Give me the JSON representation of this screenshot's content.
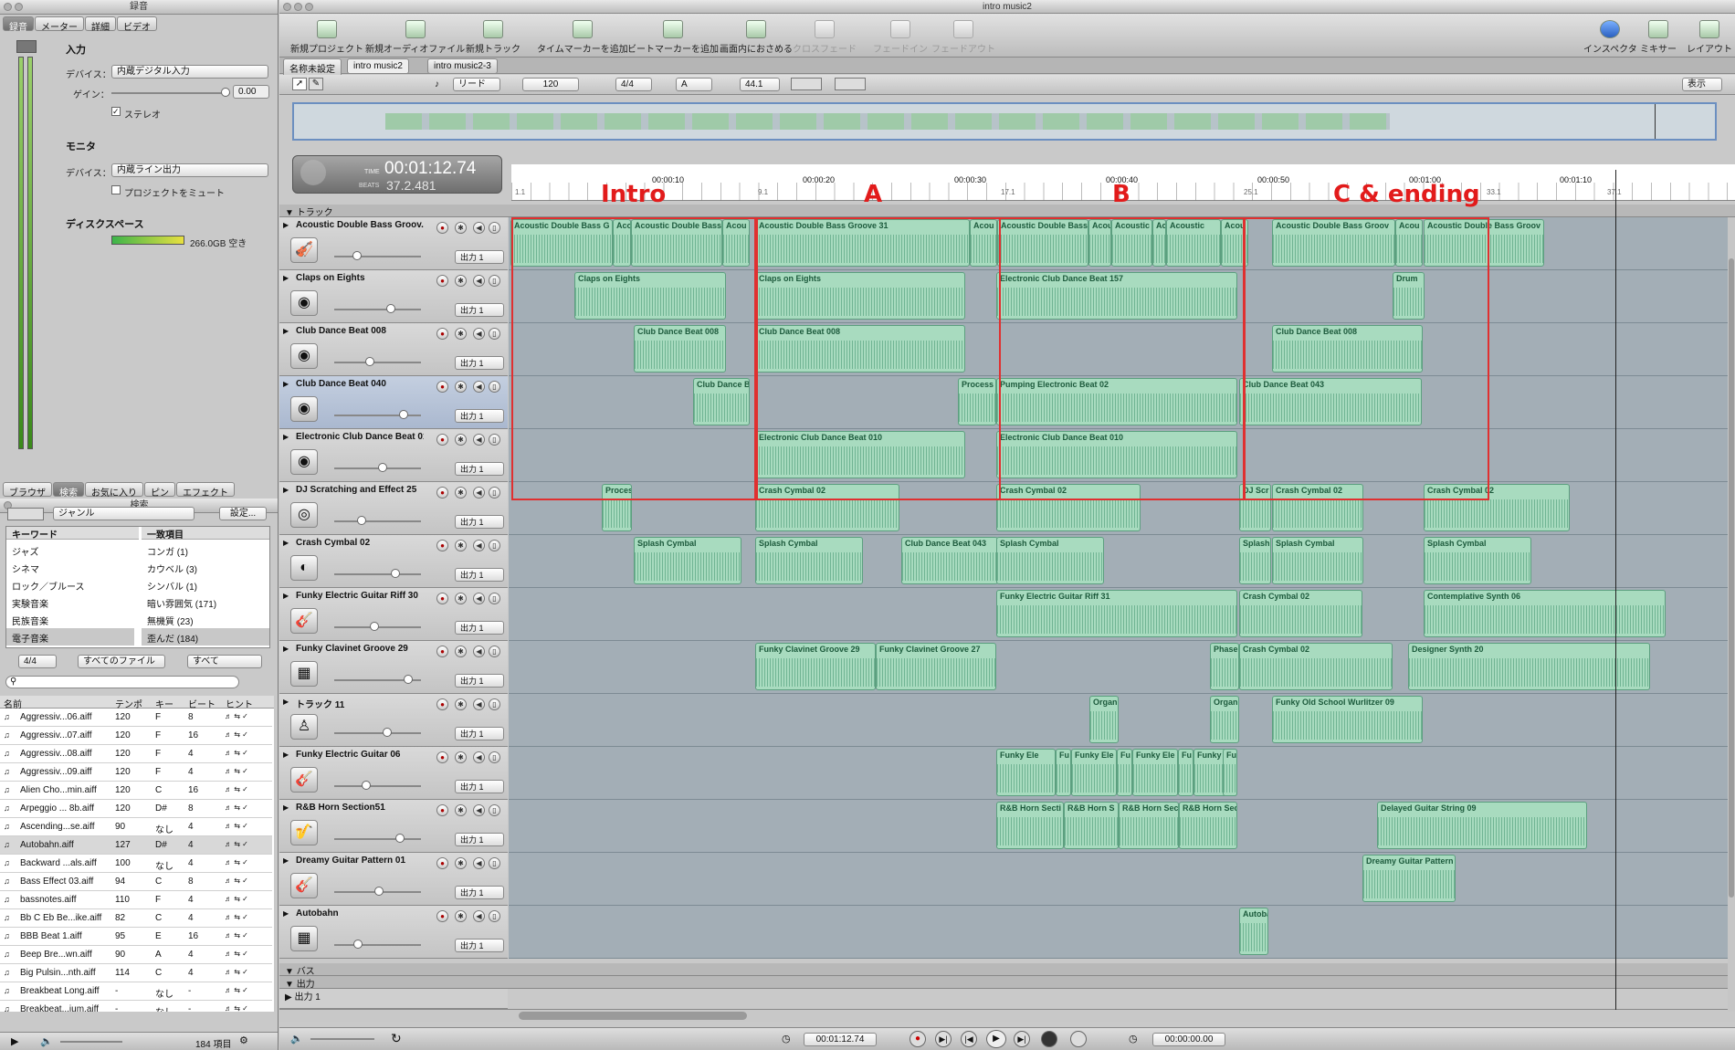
{
  "left_window_title": "録音",
  "left_tabs": [
    "録音",
    "メーター",
    "詳細",
    "ビデオ"
  ],
  "input": {
    "heading": "入力",
    "device_label": "デバイス：",
    "device_value": "内蔵デジタル入力",
    "gain_label": "ゲイン：",
    "gain_value": "0.00",
    "stereo": "ステレオ"
  },
  "monitor": {
    "heading": "モニタ",
    "device_label": "デバイス：",
    "device_value": "内蔵ライン出力",
    "mute": "プロジェクトをミュート"
  },
  "disk": {
    "heading": "ディスクスペース",
    "free": "266.0GB 空き"
  },
  "browser_title": "検索",
  "browser_tabs": [
    "ブラウザ",
    "検索",
    "お気に入り",
    "ピン",
    "エフェクト"
  ],
  "genre_select": "ジャンル",
  "settings_btn": "設定...",
  "keyword_header": "キーワード",
  "match_header": "一致項目",
  "keywords": [
    "ジャズ",
    "シネマ",
    "ロック／ブルース",
    "実験音楽",
    "民族音楽",
    "電子音楽"
  ],
  "matches": [
    "コンガ (1)",
    "カウベル (3)",
    "シンバル (1)",
    "暗い雰囲気 (171)",
    "無機質 (23)",
    "歪んだ (184)"
  ],
  "filter": {
    "sig": "4/4",
    "files": "すべてのファイル",
    "all": "すべて"
  },
  "file_cols": [
    "名前",
    "テンポ",
    "キー",
    "ビート",
    "ヒント"
  ],
  "files": [
    [
      "Aggressiv...06.aiff",
      "120",
      "F",
      "8"
    ],
    [
      "Aggressiv...07.aiff",
      "120",
      "F",
      "16"
    ],
    [
      "Aggressiv...08.aiff",
      "120",
      "F",
      "4"
    ],
    [
      "Aggressiv...09.aiff",
      "120",
      "F",
      "4"
    ],
    [
      "Alien Cho...min.aiff",
      "120",
      "C",
      "16"
    ],
    [
      "Arpeggio ... 8b.aiff",
      "120",
      "D#",
      "8"
    ],
    [
      "Ascending...se.aiff",
      "90",
      "なし",
      "4"
    ],
    [
      "Autobahn.aiff",
      "127",
      "D#",
      "4"
    ],
    [
      "Backward ...als.aiff",
      "100",
      "なし",
      "4"
    ],
    [
      "Bass Effect 03.aiff",
      "94",
      "C",
      "8"
    ],
    [
      "bassnotes.aiff",
      "110",
      "F",
      "4"
    ],
    [
      "Bb C Eb Be...ike.aiff",
      "82",
      "C",
      "4"
    ],
    [
      "BBB Beat 1.aiff",
      "95",
      "E",
      "16"
    ],
    [
      "Beep Bre...wn.aiff",
      "90",
      "A",
      "4"
    ],
    [
      "Big Pulsin...nth.aiff",
      "114",
      "C",
      "4"
    ],
    [
      "Breakbeat Long.aiff",
      "-",
      "なし",
      "-"
    ],
    [
      "Breakbeat...ium.aiff",
      "-",
      "なし",
      "-"
    ]
  ],
  "item_count": "184 項目",
  "main_title": "intro music2",
  "toolbar": [
    "新規プロジェクト",
    "新規オーディオファイル",
    "新規トラック",
    "タイムマーカーを追加",
    "ビートマーカーを追加",
    "画面内におさめる",
    "クロスフェード",
    "フェードイン",
    "フェードアウト"
  ],
  "toolbar_right": [
    "インスペクタ",
    "ミキサー",
    "レイアウト"
  ],
  "doc_tabs": [
    "名称未設定",
    "intro music2",
    "intro music2-3"
  ],
  "controls": {
    "mode": "リード",
    "tempo": "120",
    "sig": "4/4",
    "key": "A",
    "rate": "44.1",
    "view": "表示"
  },
  "time": {
    "label": "TIME",
    "value": "00:01:12.74",
    "beats_label": "BEATS",
    "beats": "37.2.481"
  },
  "ruler_times": [
    "00:00:10",
    "00:00:20",
    "00:00:30",
    "00:00:40",
    "00:00:50",
    "00:01:00",
    "00:01:10"
  ],
  "ruler_beats": [
    "1.1",
    "9.1",
    "17.1",
    "25.1",
    "33.1",
    "37.1"
  ],
  "tracks_header": "トラック",
  "sections": [
    "Intro",
    "A",
    "B",
    "C & ending"
  ],
  "tracks": [
    {
      "name": "Acoustic Double Bass Groov...",
      "icon": "🎻"
    },
    {
      "name": "Claps on Eights",
      "icon": "◉"
    },
    {
      "name": "Club Dance Beat 008",
      "icon": "◉"
    },
    {
      "name": "Club Dance Beat 040",
      "icon": "◉"
    },
    {
      "name": "Electronic Club Dance Beat 010",
      "icon": "◉"
    },
    {
      "name": "DJ Scratching and Effect 25",
      "icon": "◎"
    },
    {
      "name": "Crash Cymbal 02",
      "icon": "◐"
    },
    {
      "name": "Funky Electric Guitar Riff 30",
      "icon": "🎸"
    },
    {
      "name": "Funky Clavinet Groove 29",
      "icon": "▦"
    },
    {
      "name": "トラック 11",
      "icon": "♙"
    },
    {
      "name": "Funky Electric Guitar 06",
      "icon": "🎸"
    },
    {
      "name": "R&B Horn Section51",
      "icon": "🎷"
    },
    {
      "name": "Dreamy Guitar Pattern 01",
      "icon": "🎸"
    },
    {
      "name": "Autobahn",
      "icon": "▦"
    }
  ],
  "out_label": "出力 1",
  "regions": [
    [
      [
        "Acoustic Double Bass G",
        0,
        112
      ],
      [
        "Aco",
        112,
        20
      ],
      [
        "Acoustic Double Bass",
        132,
        100
      ],
      [
        "Acou",
        232,
        30
      ],
      [
        "Acoustic Double Bass Groove 31",
        268,
        235
      ],
      [
        "Acou",
        503,
        30
      ],
      [
        "Acoustic Double Bass",
        533,
        100
      ],
      [
        "Acou",
        633,
        25
      ],
      [
        "Acoustic D",
        658,
        45
      ],
      [
        "Acou",
        703,
        15
      ],
      [
        "Acoustic",
        718,
        60
      ],
      [
        "Acou",
        778,
        30
      ],
      [
        "Acoustic Double Bass Groov",
        834,
        135
      ],
      [
        "Acou",
        969,
        30
      ],
      [
        "Acoustic Double Bass Groov",
        1000,
        132
      ]
    ],
    [
      [
        "Claps on Eights",
        70,
        166
      ],
      [
        "Claps on Eights",
        268,
        230
      ],
      [
        "Electronic Club Dance Beat 157",
        532,
        264
      ],
      [
        "Drum",
        966,
        35
      ]
    ],
    [
      [
        "Club Dance Beat 008",
        135,
        101
      ],
      [
        "Club Dance Beat 008",
        268,
        230
      ],
      [
        "Club Dance Beat 008",
        834,
        165
      ]
    ],
    [
      [
        "Club Dance B",
        200,
        62
      ],
      [
        "Process",
        490,
        42
      ],
      [
        "Pumping Electronic Beat 02",
        532,
        264
      ],
      [
        "Club Dance Beat 043",
        798,
        200
      ]
    ],
    [
      [
        "Electronic Club Dance Beat 010",
        268,
        230
      ],
      [
        "Electronic Club Dance Beat 010",
        532,
        264
      ]
    ],
    [
      [
        "Proces",
        100,
        33
      ],
      [
        "Crash Cymbal 02",
        268,
        158
      ],
      [
        "Crash Cymbal 02",
        532,
        158
      ],
      [
        "DJ Scr",
        798,
        35
      ],
      [
        "Crash Cymbal 02",
        834,
        100
      ],
      [
        "Crash Cymbal 02",
        1000,
        160
      ]
    ],
    [
      [
        "Splash Cymbal",
        135,
        118
      ],
      [
        "Splash Cymbal",
        268,
        118
      ],
      [
        "Club Dance Beat 043",
        428,
        106
      ],
      [
        "Splash Cymbal",
        532,
        118
      ],
      [
        "Splash",
        798,
        35
      ],
      [
        "Splash Cymbal",
        834,
        100
      ],
      [
        "Splash Cymbal",
        1000,
        118
      ]
    ],
    [
      [
        "Funky Electric Guitar Riff 31",
        532,
        264
      ],
      [
        "Crash Cymbal 02",
        798,
        135
      ],
      [
        "Contemplative Synth 06",
        1000,
        265
      ]
    ],
    [
      [
        "Funky Clavinet Groove 29",
        268,
        132
      ],
      [
        "Funky Clavinet Groove 27",
        400,
        132
      ],
      [
        "Phase",
        766,
        32
      ],
      [
        "Crash Cymbal 02",
        798,
        168
      ],
      [
        "Designer Synth  20",
        983,
        265
      ]
    ],
    [
      [
        "Organ",
        634,
        32
      ],
      [
        "Organ",
        766,
        32
      ],
      [
        "Funky Old School Wurlitzer 09",
        834,
        165
      ]
    ],
    [
      [
        "Funky Ele",
        532,
        65
      ],
      [
        "Fu",
        597,
        17
      ],
      [
        "Funky Ele",
        614,
        50
      ],
      [
        "Fu",
        664,
        17
      ],
      [
        "Funky Ele",
        681,
        50
      ],
      [
        "Fu",
        731,
        17
      ],
      [
        "Funky Ele",
        748,
        48
      ],
      [
        "Fu",
        780,
        16
      ]
    ],
    [
      [
        "R&B Horn Secti",
        532,
        74
      ],
      [
        "R&B Horn S",
        606,
        60
      ],
      [
        "R&B Horn Sec",
        666,
        66
      ],
      [
        "R&B Horn Sec",
        732,
        64
      ],
      [
        "Delayed Guitar String 09",
        949,
        230
      ]
    ],
    [
      [
        "Dreamy Guitar Pattern",
        933,
        102
      ]
    ],
    [
      [
        "Autoba",
        798,
        32
      ]
    ]
  ],
  "bus_header": "バス",
  "out_header": "出力",
  "out_track": "出力 1",
  "transport": {
    "time": "00:01:12.74",
    "end_time": "00:00:00.00"
  }
}
